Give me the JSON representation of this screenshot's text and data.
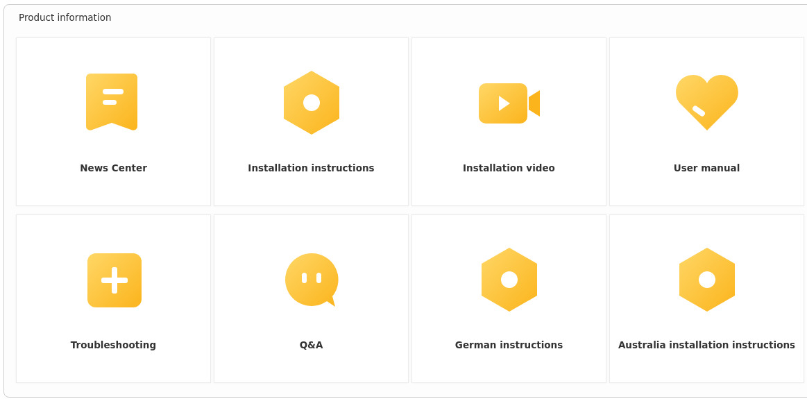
{
  "panel": {
    "title": "Product information"
  },
  "cards": [
    {
      "label": "News Center",
      "kind": "document"
    },
    {
      "label": "Installation instructions",
      "kind": "nut"
    },
    {
      "label": "Installation video",
      "kind": "video"
    },
    {
      "label": "User manual",
      "kind": "heart"
    },
    {
      "label": "Troubleshooting",
      "kind": "plus"
    },
    {
      "label": "Q&A",
      "kind": "chat"
    },
    {
      "label": "German instructions",
      "kind": "nut"
    },
    {
      "label": "Australia installation instructions",
      "kind": "nut"
    }
  ]
}
